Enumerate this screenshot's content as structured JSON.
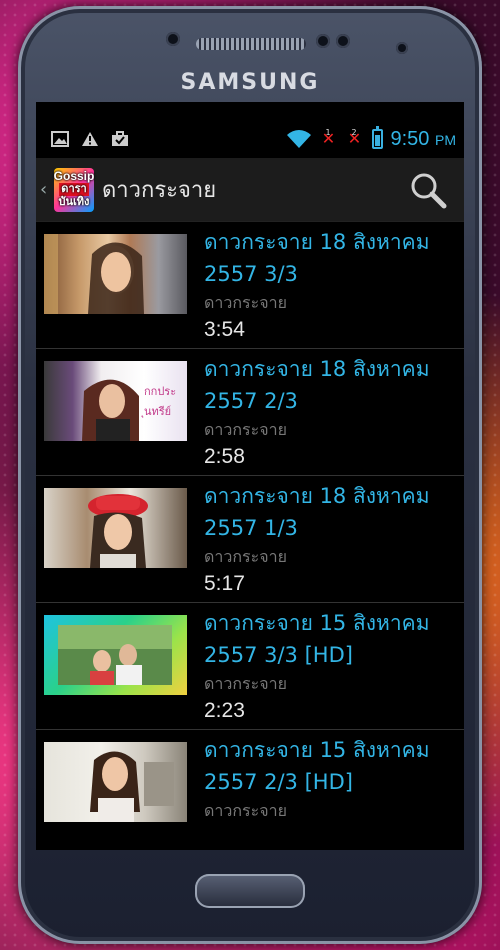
{
  "device": {
    "brand": "SAMSUNG"
  },
  "status_bar": {
    "left_icons": [
      "image-icon",
      "warning-icon",
      "briefcase-check-icon"
    ],
    "sim1": "1",
    "sim2": "2",
    "time": "9:50",
    "ampm": "PM"
  },
  "action_bar": {
    "app_logo": {
      "line1": "Gossip",
      "line2": "ดารา",
      "line3": "บันเทิง"
    },
    "title": "ดาวกระจาย"
  },
  "videos": [
    {
      "title": "ดาวกระจาย 18 สิงหาคม 2557 3/3",
      "channel": "ดาวกระจาย",
      "duration": "3:54"
    },
    {
      "title": "ดาวกระจาย 18 สิงหาคม 2557 2/3",
      "channel": "ดาวกระจาย",
      "duration": "2:58"
    },
    {
      "title": "ดาวกระจาย 18 สิงหาคม 2557 1/3",
      "channel": "ดาวกระจาย",
      "duration": "5:17"
    },
    {
      "title": "ดาวกระจาย 15 สิงหาคม 2557 3/3 [HD]",
      "channel": "ดาวกระจาย",
      "duration": "2:23"
    },
    {
      "title": "ดาวกระจาย 15 สิงหาคม 2557 2/3 [HD]",
      "channel": "ดาวกระจาย",
      "duration": ""
    }
  ],
  "colors": {
    "accent": "#33b5e5",
    "background": "#000000",
    "action_bar": "#1c1c1c"
  }
}
